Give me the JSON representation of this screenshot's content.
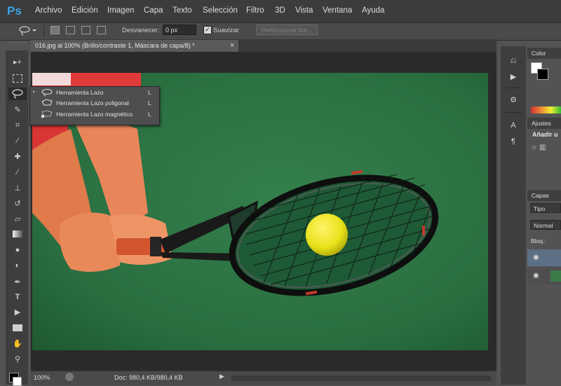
{
  "app": {
    "logo": "Ps"
  },
  "menu": [
    "Archivo",
    "Edición",
    "Imagen",
    "Capa",
    "Texto",
    "Selección",
    "Filtro",
    "3D",
    "Vista",
    "Ventana",
    "Ayuda"
  ],
  "options": {
    "feather_label": "Desvanecer:",
    "feather_value": "0 px",
    "antialias_checked": "✓",
    "antialias_label": "Suavizar",
    "refine_label": "Perfeccionar bor..."
  },
  "document": {
    "tab_title": "016.jpg al 100% (Brillo/contraste 1, Máscara de capa/8) *",
    "close_glyph": "×"
  },
  "flyout": {
    "bullet": "▪",
    "items": [
      {
        "label": "Herramienta Lazo",
        "key": "L"
      },
      {
        "label": "Herramienta Lazo poligonal",
        "key": "L"
      },
      {
        "label": "Herramienta Lazo magnético",
        "key": "L"
      }
    ]
  },
  "status": {
    "zoom": "100%",
    "doc_size": "Doc: 980,4 KB/980,4 KB"
  },
  "panels": {
    "color_tab": "Color",
    "adjustments_tab": "Ajustes",
    "adjustments_text": "Añadir u",
    "layers_tab": "Capas",
    "filter_kind": "Tipo",
    "blend_mode": "Normal",
    "lock_label": "Bloq.:"
  },
  "colors": {
    "accent": "#3aa1e8",
    "court": "#2d7a48",
    "ball": "#e8e21a",
    "shirt": "#e23a3a"
  }
}
